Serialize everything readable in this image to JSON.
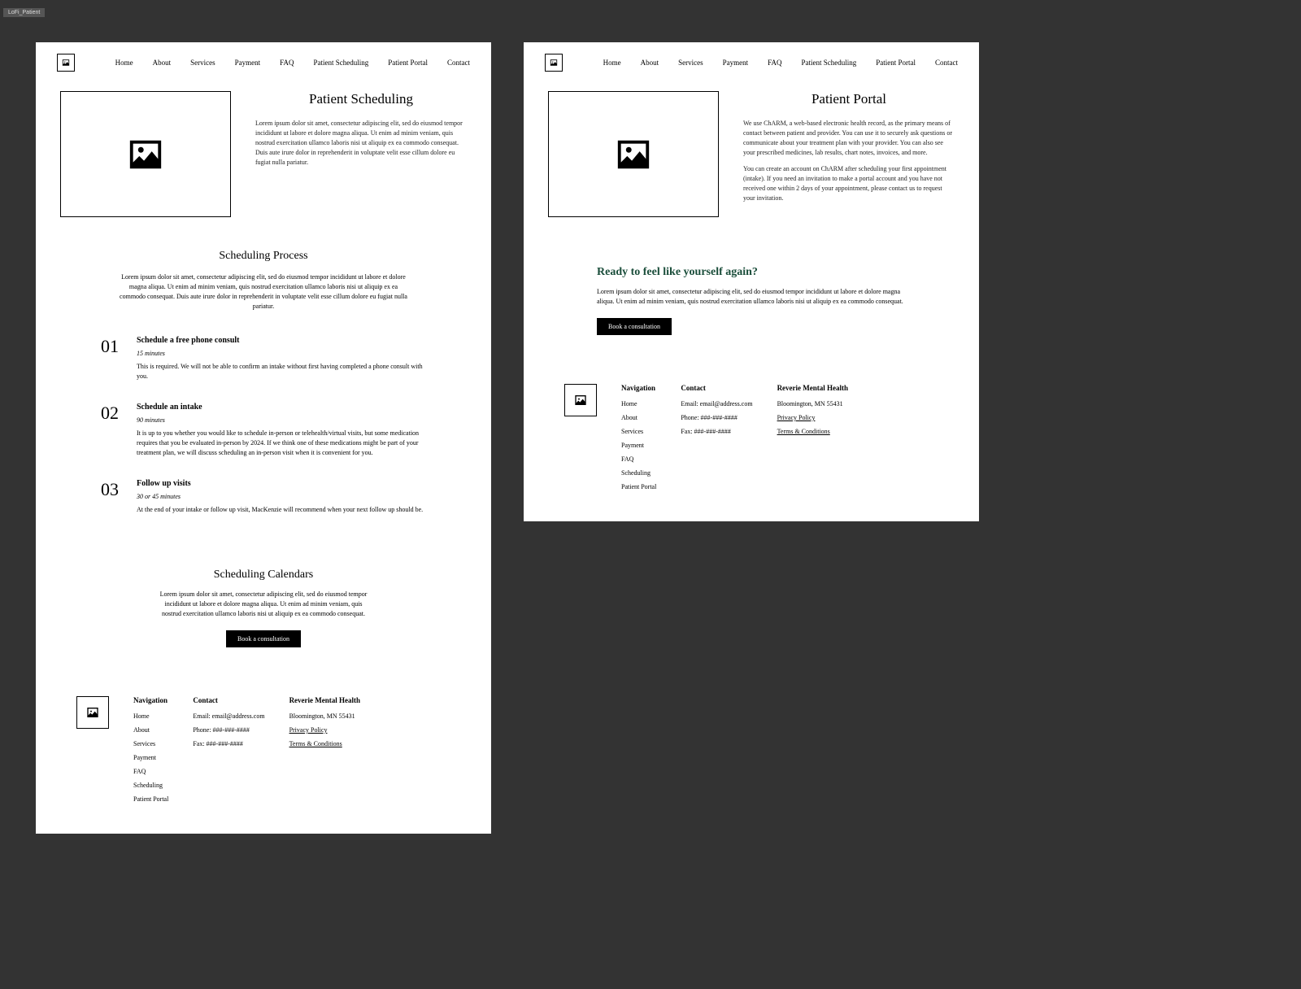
{
  "tab": "LoFi_Patient",
  "nav": [
    "Home",
    "About",
    "Services",
    "Payment",
    "FAQ",
    "Patient Scheduling",
    "Patient Portal",
    "Contact"
  ],
  "page1": {
    "hero_title": "Patient Scheduling",
    "hero_body": "Lorem ipsum dolor sit amet, consectetur adipiscing elit, sed do eiusmod tempor incididunt ut labore et dolore magna aliqua. Ut enim ad minim veniam, quis nostrud exercitation ullamco laboris nisi ut aliquip ex ea commodo consequat. Duis aute irure dolor in reprehenderit in voluptate velit esse cillum dolore eu fugiat nulla pariatur.",
    "process_title": "Scheduling Process",
    "process_body": "Lorem ipsum dolor sit amet, consectetur adipiscing elit, sed do eiusmod tempor incididunt ut labore et dolore magna aliqua. Ut enim ad minim veniam, quis nostrud exercitation ullamco laboris nisi ut aliquip ex ea commodo consequat. Duis aute irure dolor in reprehenderit in voluptate velit esse cillum dolore eu fugiat nulla pariatur.",
    "steps": [
      {
        "num": "01",
        "title": "Schedule a free phone consult",
        "duration": "15 minutes",
        "desc": "This is required. We will not be able to confirm an intake without first having completed a phone consult with you."
      },
      {
        "num": "02",
        "title": "Schedule an intake",
        "duration": "90 minutes",
        "desc": "It is up to you whether you would like to schedule in-person or telehealth/virtual visits, but some medication requires that you be evaluated in-person by 2024. If we think one of these medications might be part of your treatment plan, we will discuss scheduling an in-person visit when it is convenient for you."
      },
      {
        "num": "03",
        "title": "Follow up visits",
        "duration": "30 or 45 minutes",
        "desc": "At the end of your intake or follow up visit, MacKenzie will recommend when your next follow up should be."
      }
    ],
    "calendars_title": "Scheduling Calendars",
    "calendars_body": "Lorem ipsum dolor sit amet, consectetur adipiscing elit, sed do eiusmod tempor incididunt ut labore et dolore magna aliqua. Ut enim ad minim veniam, quis nostrud exercitation ullamco laboris nisi ut aliquip ex ea commodo consequat.",
    "cta_label": "Book a consultation"
  },
  "page2": {
    "hero_title": "Patient Portal",
    "hero_p1": "We use ChARM, a web-based electronic health record, as the primary means of contact between patient and provider. You can use it to securely ask questions or communicate about your treatment plan with your provider. You can also see your prescribed medicines, lab results, chart notes, invoices, and more.",
    "hero_p2": "You can create an account on ChARM after scheduling your first appointment (intake). If you need an invitation to make a portal account and you have not received one within 2 days of your appointment, please contact us to request your invitation.",
    "feel_title": "Ready to feel like yourself again?",
    "feel_body": "Lorem ipsum dolor sit amet, consectetur adipiscing elit, sed do eiusmod tempor incididunt ut labore et dolore magna aliqua. Ut enim ad minim veniam, quis nostrud exercitation ullamco laboris nisi ut aliquip ex ea commodo consequat.",
    "cta_label": "Book a consultation"
  },
  "footer": {
    "nav_title": "Navigation",
    "nav_col1": [
      "Home",
      "About",
      "Services",
      "Payment"
    ],
    "nav_col2": [
      "FAQ",
      "Scheduling",
      "Patient Portal"
    ],
    "contact_title": "Contact",
    "contact_email": "Email: email@address.com",
    "contact_phone": "Phone: ###-###-####",
    "contact_fax": "Fax: ###-###-####",
    "company_title": "Reverie Mental Health",
    "address": "Bloomington, MN 55431",
    "privacy": "Privacy Policy",
    "terms": "Terms & Conditions"
  }
}
